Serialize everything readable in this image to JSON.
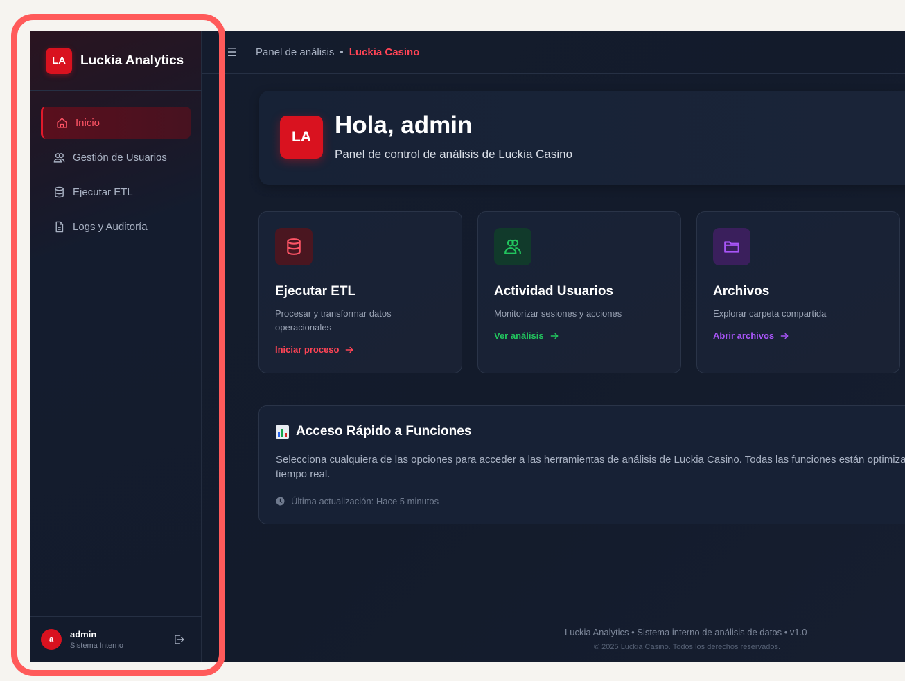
{
  "brand": {
    "logo": "LA",
    "name": "Luckia Analytics"
  },
  "sidebar": {
    "items": [
      {
        "label": "Inicio",
        "icon": "home-icon",
        "active": true
      },
      {
        "label": "Gestión de Usuarios",
        "icon": "users-icon",
        "active": false
      },
      {
        "label": "Ejecutar ETL",
        "icon": "database-icon",
        "active": false
      },
      {
        "label": "Logs y Auditoría",
        "icon": "file-text-icon",
        "active": false
      }
    ],
    "user": {
      "initial": "a",
      "name": "admin",
      "role": "Sistema Interno"
    }
  },
  "topbar": {
    "crumb_root": "Panel de análisis",
    "crumb_sep": "•",
    "crumb_current": "Luckia Casino"
  },
  "hero": {
    "logo": "LA",
    "title": "Hola, admin",
    "subtitle": "Panel de control de análisis de Luckia Casino"
  },
  "cards": [
    {
      "title": "Ejecutar ETL",
      "desc": "Procesar y transformar datos operacionales",
      "link": "Iniciar proceso",
      "icon": "database-icon"
    },
    {
      "title": "Actividad Usuarios",
      "desc": "Monitorizar sesiones y acciones",
      "link": "Ver análisis",
      "icon": "users-icon"
    },
    {
      "title": "Archivos",
      "desc": "Explorar carpeta compartida",
      "link": "Abrir archivos",
      "icon": "folder-icon"
    }
  ],
  "quick": {
    "title": "Acceso Rápido a Funciones",
    "desc_line1": "Selecciona cualquiera de las opciones para acceder a las herramientas de análisis de Luckia Casino. Todas las funciones están optimiza",
    "desc_line2": "tiempo real.",
    "meta": "Última actualización: Hace 5 minutos"
  },
  "footer": {
    "line1": "Luckia Analytics • Sistema interno de análisis de datos • v1.0",
    "line2": "© 2025 Luckia Casino. Todos los derechos reservados."
  },
  "colors": {
    "accent": "#d9121f",
    "green": "#22c55e",
    "purple": "#a855f7",
    "red_link": "#ff4455"
  }
}
